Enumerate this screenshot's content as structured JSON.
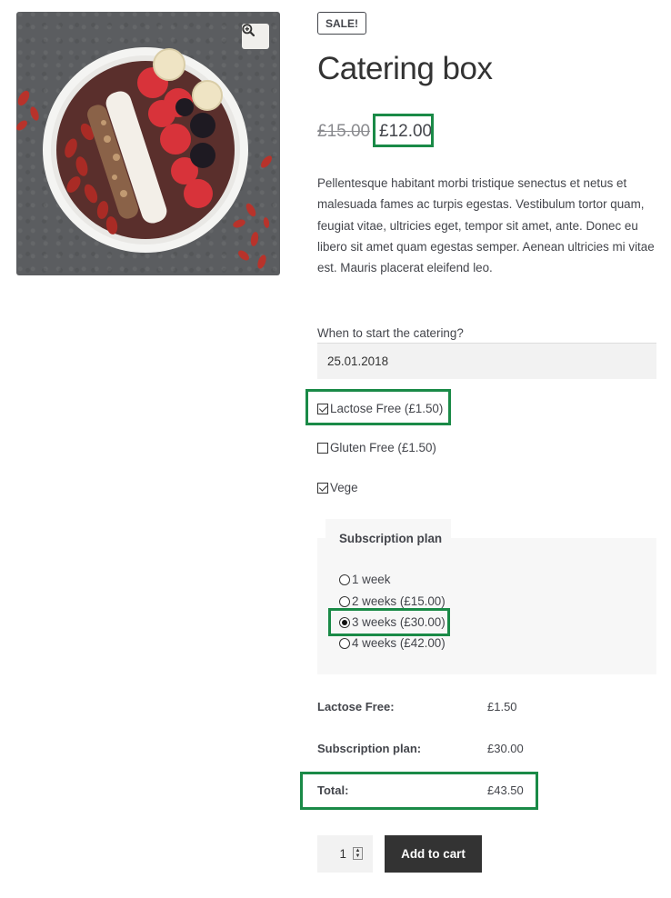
{
  "product": {
    "sale_badge": "SALE!",
    "title": "Catering box",
    "price_old": "£15.00",
    "price_new": "£12.00",
    "description": "Pellentesque habitant morbi tristique senectus et netus et malesuada fames ac turpis egestas. Vestibulum tortor quam, feugiat vitae, ultricies eget, tempor sit amet, ante. Donec eu libero sit amet quam egestas semper. Aenean ultricies mi vitae est. Mauris placerat eleifend leo.",
    "image_icon": "acai-bowl-product-photo",
    "zoom_icon": "magnifier-plus-icon"
  },
  "form": {
    "start_label": "When to start the catering?",
    "start_value": "25.01.2018",
    "checkboxes": [
      {
        "label": "Lactose Free (£1.50)",
        "checked": true
      },
      {
        "label": "Gluten Free (£1.50)",
        "checked": false
      },
      {
        "label": "Vege",
        "checked": true
      }
    ],
    "subscription": {
      "legend": "Subscription plan",
      "options": [
        {
          "label": "1 week",
          "checked": false
        },
        {
          "label": "2 weeks (£15.00)",
          "checked": false
        },
        {
          "label": "3 weeks (£30.00)",
          "checked": true
        },
        {
          "label": "4 weeks (£42.00)",
          "checked": false
        }
      ]
    }
  },
  "totals": {
    "rows": [
      {
        "label": "Lactose Free:",
        "value": "£1.50"
      },
      {
        "label": "Subscription plan:",
        "value": "£30.00"
      },
      {
        "label": "Total:",
        "value": "£43.50"
      }
    ]
  },
  "cart": {
    "quantity": "1",
    "add_label": "Add to cart"
  },
  "colors": {
    "highlight": "#1a8a47",
    "button": "#333333",
    "field_bg": "#f2f2f2"
  }
}
